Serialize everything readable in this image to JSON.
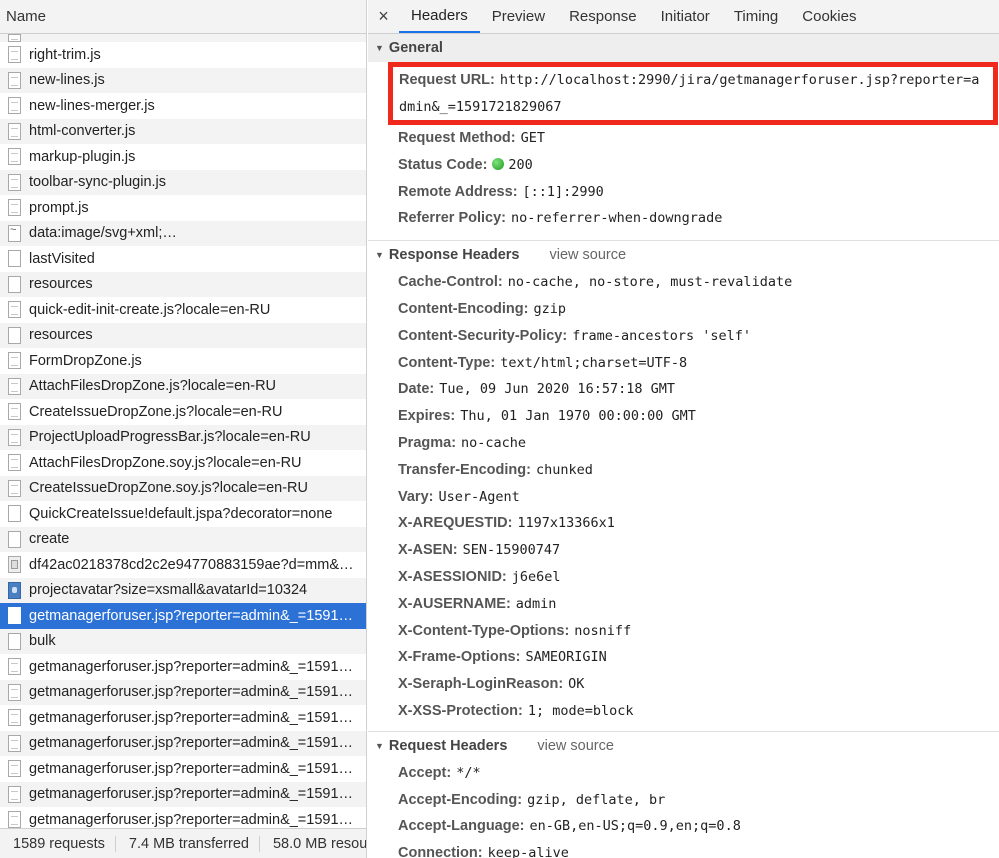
{
  "list": {
    "header": "Name",
    "rows": [
      {
        "name": "",
        "icon": "script",
        "partial": true
      },
      {
        "name": "right-trim.js",
        "icon": "script"
      },
      {
        "name": "new-lines.js",
        "icon": "script"
      },
      {
        "name": "new-lines-merger.js",
        "icon": "script"
      },
      {
        "name": "html-converter.js",
        "icon": "script"
      },
      {
        "name": "markup-plugin.js",
        "icon": "script"
      },
      {
        "name": "toolbar-sync-plugin.js",
        "icon": "script"
      },
      {
        "name": "prompt.js",
        "icon": "script"
      },
      {
        "name": "data:image/svg+xml;…",
        "icon": "svgimg"
      },
      {
        "name": "lastVisited",
        "icon": "blank"
      },
      {
        "name": "resources",
        "icon": "blank"
      },
      {
        "name": "quick-edit-init-create.js?locale=en-RU",
        "icon": "script"
      },
      {
        "name": "resources",
        "icon": "blank"
      },
      {
        "name": "FormDropZone.js",
        "icon": "script"
      },
      {
        "name": "AttachFilesDropZone.js?locale=en-RU",
        "icon": "script"
      },
      {
        "name": "CreateIssueDropZone.js?locale=en-RU",
        "icon": "script"
      },
      {
        "name": "ProjectUploadProgressBar.js?locale=en-RU",
        "icon": "script"
      },
      {
        "name": "AttachFilesDropZone.soy.js?locale=en-RU",
        "icon": "script"
      },
      {
        "name": "CreateIssueDropZone.soy.js?locale=en-RU",
        "icon": "script"
      },
      {
        "name": "QuickCreateIssue!default.jspa?decorator=none",
        "icon": "blank"
      },
      {
        "name": "create",
        "icon": "blank"
      },
      {
        "name": "df42ac0218378cd2c2e94770883159ae?d=mm&…",
        "icon": "img"
      },
      {
        "name": "projectavatar?size=xsmall&avatarId=10324",
        "icon": "avatar"
      },
      {
        "name": "getmanagerforuser.jsp?reporter=admin&_=1591…",
        "icon": "blank",
        "selected": true
      },
      {
        "name": "bulk",
        "icon": "blank"
      },
      {
        "name": "getmanagerforuser.jsp?reporter=admin&_=1591…",
        "icon": "script"
      },
      {
        "name": "getmanagerforuser.jsp?reporter=admin&_=1591…",
        "icon": "script"
      },
      {
        "name": "getmanagerforuser.jsp?reporter=admin&_=1591…",
        "icon": "script"
      },
      {
        "name": "getmanagerforuser.jsp?reporter=admin&_=1591…",
        "icon": "script"
      },
      {
        "name": "getmanagerforuser.jsp?reporter=admin&_=1591…",
        "icon": "script"
      },
      {
        "name": "getmanagerforuser.jsp?reporter=admin&_=1591…",
        "icon": "script"
      },
      {
        "name": "getmanagerforuser.jsp?reporter=admin&_=1591…",
        "icon": "script"
      }
    ],
    "footer": {
      "requests": "1589 requests",
      "transferred": "7.4 MB transferred",
      "resources": "58.0 MB resou"
    }
  },
  "tabs": {
    "close": "×",
    "items": [
      "Headers",
      "Preview",
      "Response",
      "Initiator",
      "Timing",
      "Cookies"
    ],
    "active": "Headers"
  },
  "general": {
    "title": "General",
    "url_key": "Request URL:",
    "url_value": "http://localhost:2990/jira/getmanagerforuser.jsp?reporter=admin&_=1591721829067",
    "rows": [
      {
        "k": "Request Method:",
        "v": "GET"
      },
      {
        "k": "Status Code:",
        "v": "200",
        "dot": true
      },
      {
        "k": "Remote Address:",
        "v": "[::1]:2990"
      },
      {
        "k": "Referrer Policy:",
        "v": "no-referrer-when-downgrade"
      }
    ]
  },
  "response_headers": {
    "title": "Response Headers",
    "view_source": "view source",
    "rows": [
      {
        "k": "Cache-Control:",
        "v": "no-cache, no-store, must-revalidate"
      },
      {
        "k": "Content-Encoding:",
        "v": "gzip"
      },
      {
        "k": "Content-Security-Policy:",
        "v": "frame-ancestors 'self'"
      },
      {
        "k": "Content-Type:",
        "v": "text/html;charset=UTF-8"
      },
      {
        "k": "Date:",
        "v": "Tue, 09 Jun 2020 16:57:18 GMT"
      },
      {
        "k": "Expires:",
        "v": "Thu, 01 Jan 1970 00:00:00 GMT"
      },
      {
        "k": "Pragma:",
        "v": "no-cache"
      },
      {
        "k": "Transfer-Encoding:",
        "v": "chunked"
      },
      {
        "k": "Vary:",
        "v": "User-Agent"
      },
      {
        "k": "X-AREQUESTID:",
        "v": "1197x13366x1"
      },
      {
        "k": "X-ASEN:",
        "v": "SEN-15900747"
      },
      {
        "k": "X-ASESSIONID:",
        "v": "j6e6el"
      },
      {
        "k": "X-AUSERNAME:",
        "v": "admin"
      },
      {
        "k": "X-Content-Type-Options:",
        "v": "nosniff"
      },
      {
        "k": "X-Frame-Options:",
        "v": "SAMEORIGIN"
      },
      {
        "k": "X-Seraph-LoginReason:",
        "v": "OK"
      },
      {
        "k": "X-XSS-Protection:",
        "v": "1; mode=block"
      }
    ]
  },
  "request_headers": {
    "title": "Request Headers",
    "view_source": "view source",
    "rows": [
      {
        "k": "Accept:",
        "v": "*/*"
      },
      {
        "k": "Accept-Encoding:",
        "v": "gzip, deflate, br"
      },
      {
        "k": "Accept-Language:",
        "v": "en-GB,en-US;q=0.9,en;q=0.8"
      },
      {
        "k": "Connection:",
        "v": "keep-alive"
      }
    ]
  },
  "colors": {
    "selected_row": "#2c72d6",
    "highlight_box": "#ef2a1c",
    "active_tab": "#1a73e8",
    "status_ok": "#1c9a1c"
  }
}
